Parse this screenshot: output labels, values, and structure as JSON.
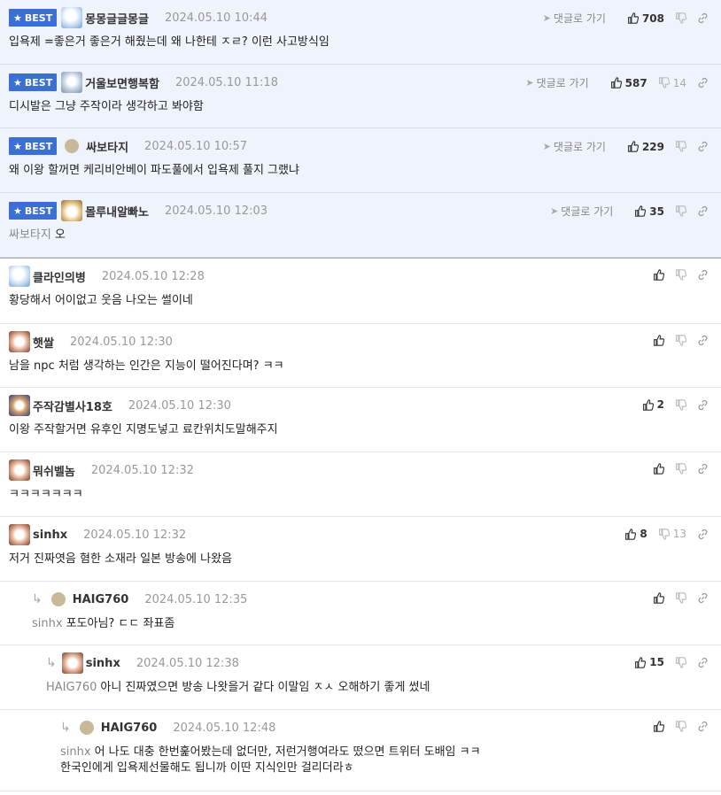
{
  "best_badge_label": "BEST",
  "reply_link_label": "댓글로 가기",
  "colors": {
    "best_bg": "#eff3fc",
    "badge": "#3c6fd6"
  },
  "comments": [
    {
      "nick": "몽몽글글몽글",
      "date": "2024.05.10 10:44",
      "text": "입욕제 =좋은거 좋은거 해줬는데 왜 나한테 ㅈㄹ? 이런 사고방식임",
      "up": "708",
      "down": ""
    },
    {
      "nick": "거울보면행복함",
      "date": "2024.05.10 11:18",
      "text": "디시발은 그냥 주작이라 생각하고 봐야함",
      "up": "587",
      "down": "14"
    },
    {
      "nick": "싸보타지",
      "date": "2024.05.10 10:57",
      "text": "왜 이왕 할꺼면 케리비안베이 파도풀에서 입욕제 풀지 그랬냐",
      "up": "229",
      "down": ""
    },
    {
      "nick": "몰루내알빠노",
      "date": "2024.05.10 12:03",
      "mention": "싸보타지",
      "text": "오",
      "up": "35",
      "down": ""
    },
    {
      "nick": "클라인의병",
      "date": "2024.05.10 12:28",
      "text": "황당해서 어이없고 웃음 나오는 썰이네",
      "up": "",
      "down": ""
    },
    {
      "nick": "햇쌀",
      "date": "2024.05.10 12:30",
      "text": "남을 npc 처럼 생각하는 인간은 지능이 떨어진다며? ㅋㅋ",
      "up": "",
      "down": ""
    },
    {
      "nick": "주작감별사18호",
      "date": "2024.05.10 12:30",
      "text": "이왕 주작할거면 유후인 지명도넣고 료칸위치도말해주지",
      "up": "2",
      "down": ""
    },
    {
      "nick": "뭐쉬벨놈",
      "date": "2024.05.10 12:32",
      "text": "ㅋㅋㅋㅋㅋㅋㅋ",
      "up": "",
      "down": ""
    },
    {
      "nick": "sinhx",
      "date": "2024.05.10 12:32",
      "text": "저거 진짜엿음 혐한 소재라 일본 방송에 나왔음",
      "up": "8",
      "down": "13"
    },
    {
      "nick": "HAIG760",
      "date": "2024.05.10 12:35",
      "mention": "sinhx",
      "text": "포도아님? ㄷㄷ 좌표좀",
      "up": "",
      "down": ""
    },
    {
      "nick": "sinhx",
      "date": "2024.05.10 12:38",
      "mention": "HAIG760",
      "text": "아니 진짜였으면 방송 나왓을거 같다 이말임 ㅈㅅ 오해하기 좋게 썼네",
      "up": "15",
      "down": ""
    },
    {
      "nick": "HAIG760",
      "date": "2024.05.10 12:48",
      "mention": "sinhx",
      "text": "어 나도 대충 한번훑어봤는데 없더만, 저런거행여라도 떴으면 트위터 도배임 ㅋㅋ",
      "text2": "한국인에게 입욕제선물해도 됩니까 이딴 지식인만 걸리더라ㅎ",
      "up": "",
      "down": ""
    }
  ]
}
